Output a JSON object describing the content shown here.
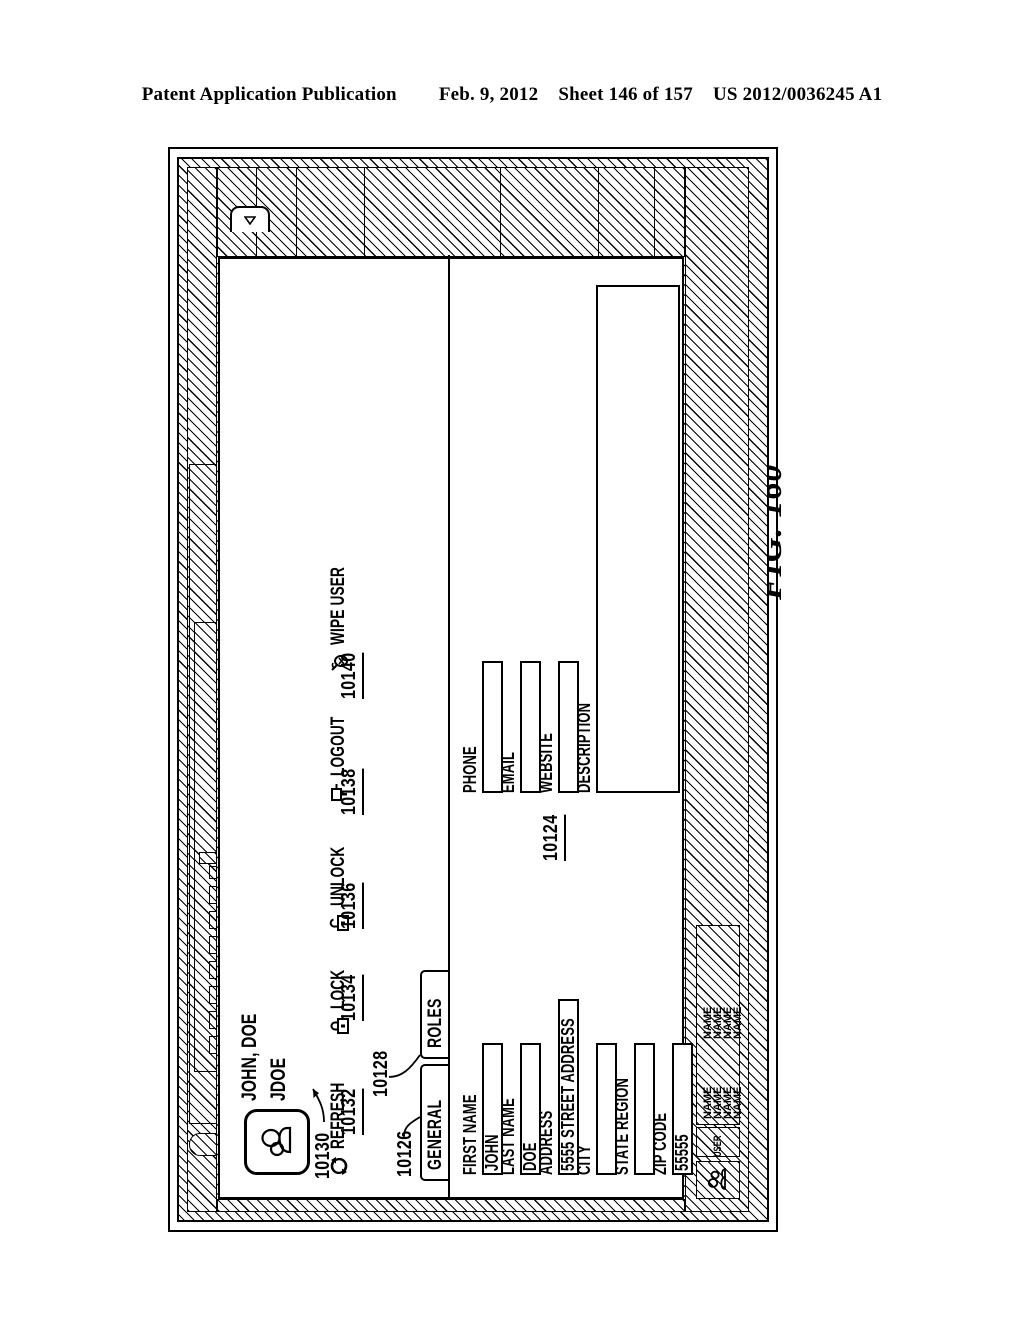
{
  "header": {
    "publication": "Patent Application Publication",
    "date": "Feb. 9, 2012",
    "sheet": "Sheet 146 of 157",
    "docnum": "US 2012/0036245 A1"
  },
  "figure": {
    "label": "FIG. 160"
  },
  "panel": {
    "ref": "10124",
    "avatar_icon": "user-avatar-icon",
    "collapse_icon": "collapse-left-arrow-icon",
    "identity": {
      "full_name": "JOHN, DOE",
      "user_name": "JDOE"
    },
    "actions_ref": "10130",
    "actions": [
      {
        "label": "REFRESH",
        "ref": "10132",
        "icon": "refresh-icon"
      },
      {
        "label": "LOCK",
        "ref": "10134",
        "icon": "lock-icon"
      },
      {
        "label": "UNLOCK",
        "ref": "10136",
        "icon": "unlock-icon"
      },
      {
        "label": "LOGOUT",
        "ref": "10138",
        "icon": "logout-icon"
      },
      {
        "label": "WIPE USER",
        "ref": "10140",
        "icon": "wipe-user-icon"
      }
    ],
    "tabs": [
      {
        "label": "GENERAL",
        "ref": "10126",
        "selected": true
      },
      {
        "label": "ROLES",
        "ref": "10128",
        "selected": false
      }
    ],
    "fields_left": [
      {
        "label": "FIRST NAME",
        "value": "JOHN"
      },
      {
        "label": "LAST NAME",
        "value": "DOE"
      },
      {
        "label": "ADDRESS",
        "value": "5555 STREET ADDRESS"
      },
      {
        "label": "CITY",
        "value": ""
      },
      {
        "label": "STATE REGION",
        "value": ""
      },
      {
        "label": "ZIP CODE",
        "value": "55555"
      }
    ],
    "fields_right": [
      {
        "label": "PHONE",
        "value": ""
      },
      {
        "label": "EMAIL",
        "value": ""
      },
      {
        "label": "WEBSITE",
        "value": ""
      }
    ],
    "description": {
      "label": "DESCRIPTION",
      "value": ""
    }
  },
  "userlist": {
    "header": "USER",
    "rows": [
      "NAME",
      "NAME",
      "NAME",
      "NAME",
      "NAME",
      "NAME",
      "NAME",
      "NAME"
    ]
  },
  "colors": {
    "ink": "#000000",
    "paper": "#ffffff"
  }
}
